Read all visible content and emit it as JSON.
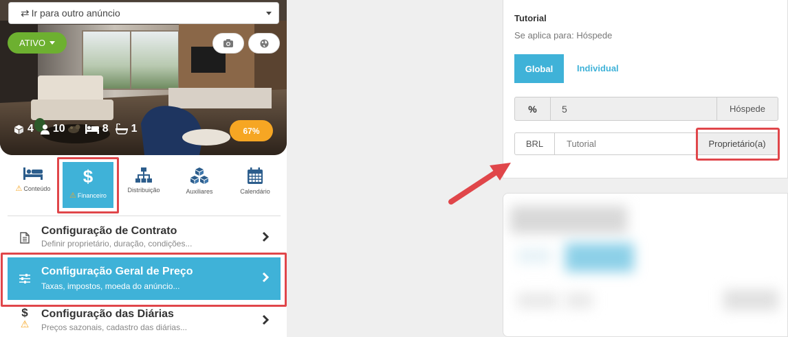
{
  "listing_selector": {
    "label": "Ir para outro anúncio",
    "icon": "swap-icon"
  },
  "hero": {
    "status_label": "ATIVO",
    "stats": {
      "bedrooms": "4",
      "guests": "10",
      "beds": "8",
      "bathrooms": "1"
    },
    "completion": "67%"
  },
  "tabs": [
    {
      "label": "Conteúdo",
      "icon": "bed-icon",
      "warning": true
    },
    {
      "label": "Financeiro",
      "icon": "dollar-icon",
      "warning": true,
      "active": true
    },
    {
      "label": "Distribuição",
      "icon": "sitemap-icon"
    },
    {
      "label": "Auxiliares",
      "icon": "cubes-icon"
    },
    {
      "label": "Calendário",
      "icon": "calendar-icon"
    }
  ],
  "menu": {
    "contrato": {
      "title": "Configuração de Contrato",
      "desc": "Definir proprietário, duração, condições..."
    },
    "preco": {
      "title": "Configuração Geral de Preço",
      "desc": "Taxas, impostos, moeda do anúncio..."
    },
    "diarias": {
      "title": "Configuração das Diárias",
      "desc": "Preços sazonais, cadastro das diárias..."
    }
  },
  "tax_panel": {
    "title": "Tutorial",
    "applies_to": "Se aplica para: Hóspede",
    "scope_global": "Global",
    "scope_individual": "Individual",
    "percent_symbol": "%",
    "percent_value": "5",
    "percent_target": "Hóspede",
    "currency": "BRL",
    "name_value": "Tutorial",
    "payer": "Proprietário(a)"
  },
  "colors": {
    "accent": "#3fb2d8",
    "active_green": "#6db030",
    "progress": "#f6a623",
    "highlight": "#e0464a"
  }
}
